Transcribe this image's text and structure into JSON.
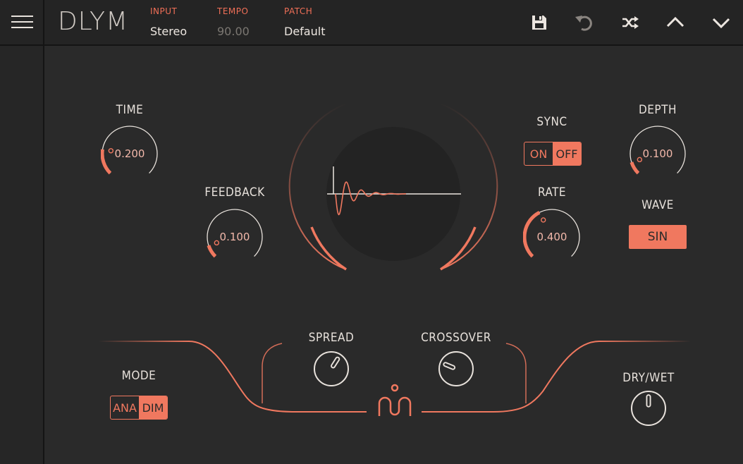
{
  "app": {
    "logo": "DLYM"
  },
  "header": {
    "input": {
      "label": "INPUT",
      "value": "Stereo"
    },
    "tempo": {
      "label": "TEMPO",
      "value": "90.00"
    },
    "patch": {
      "label": "PATCH",
      "value": "Default"
    }
  },
  "toolbar": {
    "icons": [
      "save-icon",
      "undo-icon",
      "shuffle-icon",
      "chevron-up-icon",
      "chevron-down-icon"
    ]
  },
  "params": {
    "time": {
      "label": "TIME",
      "value": "0.200",
      "level": 0.2
    },
    "feedback": {
      "label": "FEEDBACK",
      "value": "0.100",
      "level": 0.1
    },
    "sync": {
      "label": "SYNC",
      "on": "ON",
      "off": "OFF",
      "selected": "OFF"
    },
    "rate": {
      "label": "RATE",
      "value": "0.400",
      "level": 0.4
    },
    "depth": {
      "label": "DEPTH",
      "value": "0.100",
      "level": 0.1
    },
    "wave": {
      "label": "WAVE",
      "value": "SIN"
    },
    "spread": {
      "label": "SPREAD",
      "level": 0.62
    },
    "crossover": {
      "label": "CROSSOVER",
      "level": 0.25
    },
    "mode": {
      "label": "MODE",
      "a": "ANA",
      "b": "DIM",
      "selected": "DIM"
    },
    "drywet": {
      "label": "DRY/WET",
      "level": 0.5
    }
  },
  "colors": {
    "accent": "#f0785f",
    "background": "#2a2a2a",
    "text": "#e8e2dc"
  }
}
